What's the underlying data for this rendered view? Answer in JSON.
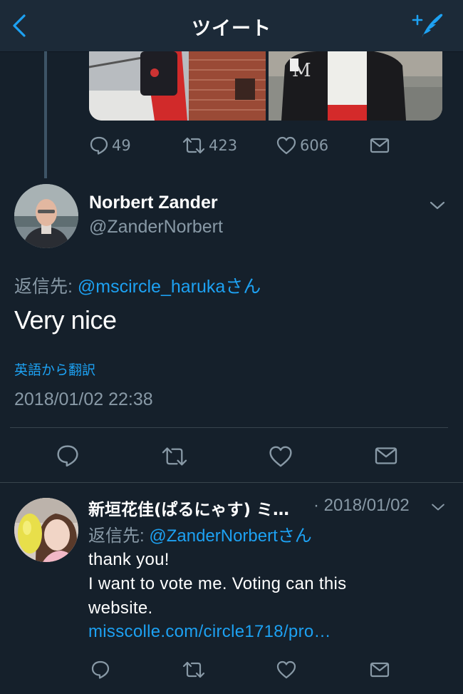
{
  "header": {
    "title": "ツイート",
    "back_icon": "chevron-left-icon",
    "compose_icon": "compose-feather-icon",
    "accent": "#1da1f2"
  },
  "previous_tweet": {
    "reply_count": "49",
    "retweet_count": "423",
    "like_count": "606"
  },
  "main_tweet": {
    "author_name": "Norbert Zander",
    "author_handle": "@ZanderNorbert",
    "reply_to_prefix": "返信先: ",
    "reply_to_user": "@mscircle_haruka",
    "reply_to_suffix": "さん",
    "text": "Very nice",
    "translate_label": "英語から翻訳",
    "timestamp": "2018/01/02 22:38"
  },
  "reply_tweet": {
    "author_name": "新垣花佳(ぱるにゃす) ミ…",
    "date": "· 2018/01/02",
    "reply_to_prefix": "返信先: ",
    "reply_to_user": "@ZanderNorbert",
    "reply_to_suffix": "さん",
    "lines": [
      "thank you!",
      "I want to vote me. Voting can this",
      "website."
    ],
    "link": "misscolle.com/circle1718/pro…"
  },
  "colors": {
    "background": "#15202b",
    "header": "#1c2a38",
    "secondary_text": "#8899a6",
    "link": "#1da1f2",
    "divider": "#38444d"
  }
}
